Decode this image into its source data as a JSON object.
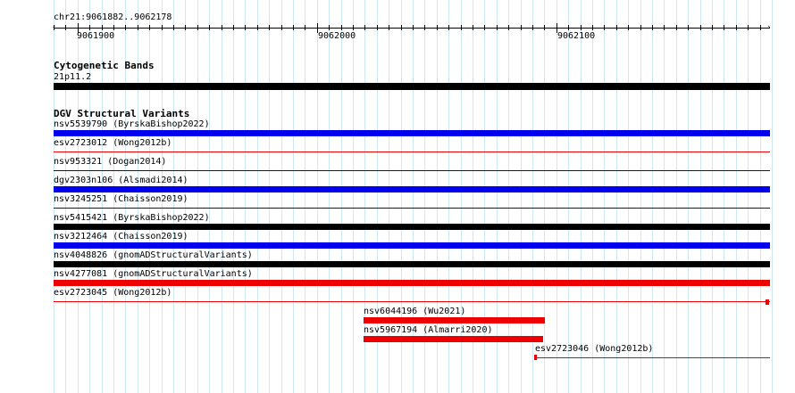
{
  "locus": "chr21:9061882..9062178",
  "ruler": {
    "labels": [
      "9061900",
      "9062000",
      "9062100"
    ]
  },
  "tracks": {
    "cytoband": {
      "title": "Cytogenetic Bands",
      "band": "21p11.2",
      "color": "#000000"
    },
    "dgv": {
      "title": "DGV Structural Variants",
      "colors": {
        "gain": "#0000ee",
        "loss": "#ee0000",
        "complex": "#000000"
      },
      "features": [
        {
          "label": "nsv5539790 (ByrskaBishop2022)",
          "type": "gain"
        },
        {
          "label": "esv2723012 (Wong2012b)",
          "type": "loss"
        },
        {
          "label": "nsv953321 (Dogan2014)",
          "type": "gain"
        },
        {
          "label": "dgv2303n106 (Alsmadi2014)",
          "type": "gain"
        },
        {
          "label": "nsv3245251 (Chaisson2019)",
          "type": "gain"
        },
        {
          "label": "nsv5415421 (ByrskaBishop2022)",
          "type": "complex"
        },
        {
          "label": "nsv3212464 (Chaisson2019)",
          "type": "gain"
        },
        {
          "label": "nsv4048826 (gnomADStructuralVariants)",
          "type": "complex"
        },
        {
          "label": "nsv4277081 (gnomADStructuralVariants)",
          "type": "loss"
        },
        {
          "label": "esv2723045 (Wong2012b)",
          "type": "loss"
        },
        {
          "label": "nsv6044196 (Wu2021)",
          "type": "loss"
        },
        {
          "label": "nsv5967194 (Almarri2020)",
          "type": "loss"
        },
        {
          "label": "esv2723046 (Wong2012b)",
          "type": "loss"
        }
      ]
    }
  }
}
